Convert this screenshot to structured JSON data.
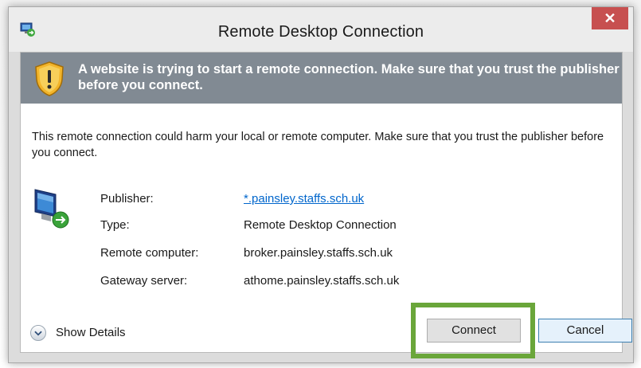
{
  "window": {
    "title": "Remote Desktop Connection",
    "close_label": "✕"
  },
  "banner": {
    "text": "A website is trying to start a remote connection. Make sure that you trust the publisher before you connect."
  },
  "description": "This remote connection could harm your local or remote computer. Make sure that you trust the publisher before you connect.",
  "details": [
    {
      "label": "Publisher:",
      "value": "*.painsley.staffs.sch.uk"
    },
    {
      "label": "Type:",
      "value": "Remote Desktop Connection"
    },
    {
      "label": "Remote computer:",
      "value": "broker.painsley.staffs.sch.uk"
    },
    {
      "label": "Gateway server:",
      "value": "athome.painsley.staffs.sch.uk"
    }
  ],
  "footer": {
    "show_details_label": "Show Details",
    "connect_label": "Connect",
    "cancel_label": "Cancel"
  },
  "colors": {
    "banner": "#818a93",
    "highlight": "#6aa63a",
    "close": "#c75050",
    "link": "#0066cc"
  },
  "icons": {
    "app": "remote-desktop-icon",
    "warning": "warning-shield-icon",
    "computer": "rdp-computer-icon",
    "expand": "chevron-down-icon"
  }
}
